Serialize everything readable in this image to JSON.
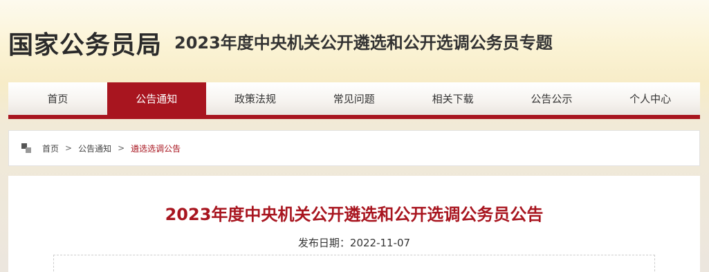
{
  "header": {
    "site_name": "国家公务员局",
    "subtitle": "2023年度中央机关公开遴选和公开选调公务员专题"
  },
  "nav": {
    "items": [
      {
        "label": "首页"
      },
      {
        "label": "公告通知",
        "active": true
      },
      {
        "label": "政策法规"
      },
      {
        "label": "常见问题"
      },
      {
        "label": "相关下载"
      },
      {
        "label": "公告公示"
      },
      {
        "label": "个人中心"
      }
    ]
  },
  "breadcrumb": {
    "home": "首页",
    "separator": ">",
    "section": "公告通知",
    "current": "遴选选调公告"
  },
  "article": {
    "title": "2023年度中央机关公开遴选和公开选调公务员公告",
    "date_label": "发布日期：",
    "date": "2022-11-07"
  },
  "colors": {
    "accent": "#a8151f",
    "header_bg": "#fbf3d4"
  }
}
